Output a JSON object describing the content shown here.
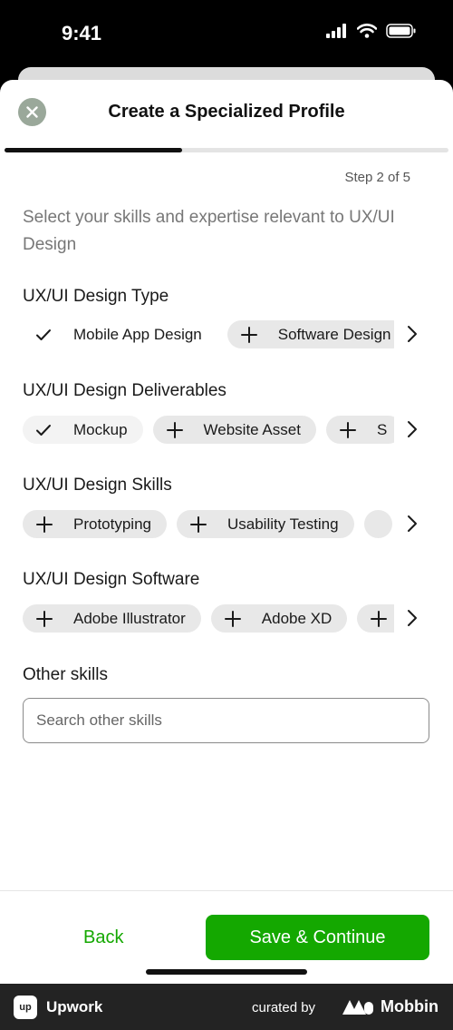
{
  "status_bar": {
    "time": "9:41"
  },
  "header": {
    "title": "Create a Specialized Profile"
  },
  "progress": {
    "fraction": 0.4,
    "step_label": "Step 2 of 5"
  },
  "intro": "Select your skills and expertise relevant to UX/UI Design",
  "sections": [
    {
      "title": "UX/UI Design Type",
      "chips": [
        {
          "label": "Mobile App Design",
          "selected": true
        },
        {
          "label": "Software Design",
          "selected": false
        }
      ]
    },
    {
      "title": "UX/UI Design Deliverables",
      "chips": [
        {
          "label": "Mockup",
          "selected": true
        },
        {
          "label": "Website Asset",
          "selected": false
        },
        {
          "label": "S",
          "selected": false
        }
      ]
    },
    {
      "title": "UX/UI Design Skills",
      "chips": [
        {
          "label": "Prototyping",
          "selected": false
        },
        {
          "label": "Usability Testing",
          "selected": false
        },
        {
          "label": "",
          "selected": false
        }
      ]
    },
    {
      "title": "UX/UI Design Software",
      "chips": [
        {
          "label": "Adobe Illustrator",
          "selected": false
        },
        {
          "label": "Adobe XD",
          "selected": false
        },
        {
          "label": "",
          "selected": false
        }
      ]
    }
  ],
  "other_skills": {
    "title": "Other skills",
    "placeholder": "Search other skills"
  },
  "footer": {
    "back_label": "Back",
    "save_label": "Save & Continue"
  },
  "brand_bar": {
    "app_name": "Upwork",
    "logo_text": "up",
    "curated_by": "curated by",
    "source": "Mobbin"
  },
  "colors": {
    "accent": "#14a800",
    "chip_bg": "#e8e8e8",
    "close_bg": "#9aa89a"
  },
  "icons": {
    "check": "check-icon",
    "plus": "plus-icon",
    "chevron": "chevron-right-icon",
    "close": "close-icon"
  }
}
